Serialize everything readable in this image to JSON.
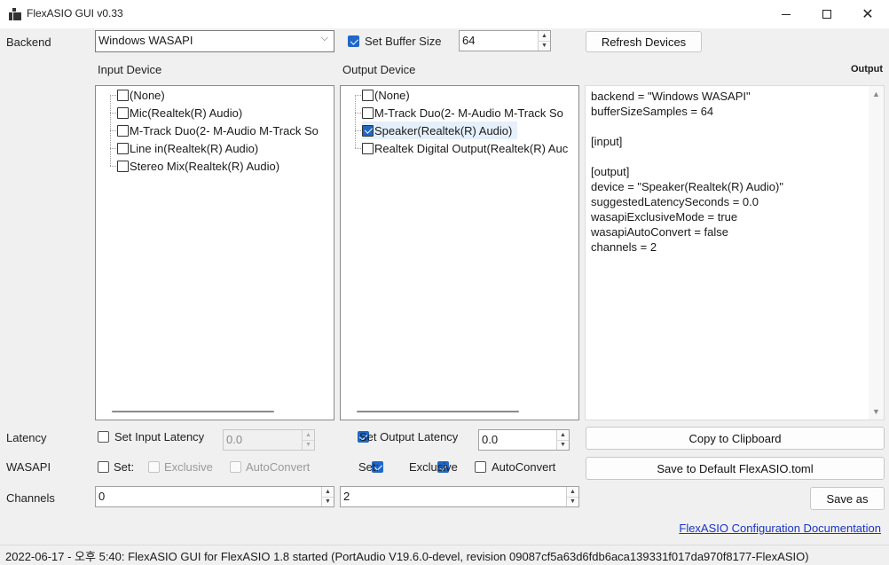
{
  "window": {
    "title": "FlexASIO GUI v0.33",
    "controls": [
      "minimize",
      "maximize",
      "close"
    ]
  },
  "backend": {
    "label": "Backend",
    "selected": "Windows WASAPI",
    "buffer_size_label": "Set Buffer Size",
    "buffer_size_checked": true,
    "buffer_size_value": "64",
    "refresh_label": "Refresh Devices"
  },
  "input_device": {
    "heading": "Input Device",
    "items": [
      {
        "label": "(None)",
        "checked": false
      },
      {
        "label": "Mic(Realtek(R) Audio)",
        "checked": false
      },
      {
        "label": "M-Track Duo(2- M-Audio M-Track So",
        "checked": false
      },
      {
        "label": "Line in(Realtek(R) Audio)",
        "checked": false
      },
      {
        "label": "Stereo Mix(Realtek(R) Audio)",
        "checked": false
      }
    ]
  },
  "output_device": {
    "heading": "Output Device",
    "items": [
      {
        "label": "(None)",
        "checked": false
      },
      {
        "label": "M-Track Duo(2- M-Audio M-Track So",
        "checked": false
      },
      {
        "label": "Speaker(Realtek(R) Audio)",
        "checked": true
      },
      {
        "label": "Realtek Digital Output(Realtek(R) Auc",
        "checked": false
      }
    ]
  },
  "output": {
    "heading": "Output",
    "text": "backend = \"Windows WASAPI\"\nbufferSizeSamples = 64\n\n[input]\n\n[output]\ndevice = \"Speaker(Realtek(R) Audio)\"\nsuggestedLatencySeconds = 0.0\nwasapiExclusiveMode = true\nwasapiAutoConvert = false\nchannels = 2"
  },
  "latency": {
    "label": "Latency",
    "input_label": "Set Input Latency",
    "input_checked": false,
    "input_value": "0.0",
    "output_label": "Set Output Latency",
    "output_checked": true,
    "output_value": "0.0",
    "copy_label": "Copy to Clipboard"
  },
  "wasapi": {
    "label": "WASAPI",
    "input_set_label": "Set:",
    "input_set_checked": false,
    "input_exclusive_label": "Exclusive",
    "input_autoconvert_label": "AutoConvert",
    "output_set_label": "Set:",
    "output_set_checked": true,
    "output_exclusive_label": "Exclusive",
    "output_exclusive_checked": true,
    "output_autoconvert_label": "AutoConvert",
    "output_autoconvert_checked": false,
    "save_default_label": "Save to Default FlexASIO.toml"
  },
  "channels": {
    "label": "Channels",
    "input_value": "0",
    "output_value": "2",
    "save_as_label": "Save as"
  },
  "doc_link": "FlexASIO Configuration Documentation",
  "status_bar": "2022-06-17 - 오후 5:40: FlexASIO GUI for FlexASIO 1.8 started (PortAudio V19.6.0-devel, revision 09087cf5a63d6fdb6aca139331f017da970f8177-FlexASIO)"
}
